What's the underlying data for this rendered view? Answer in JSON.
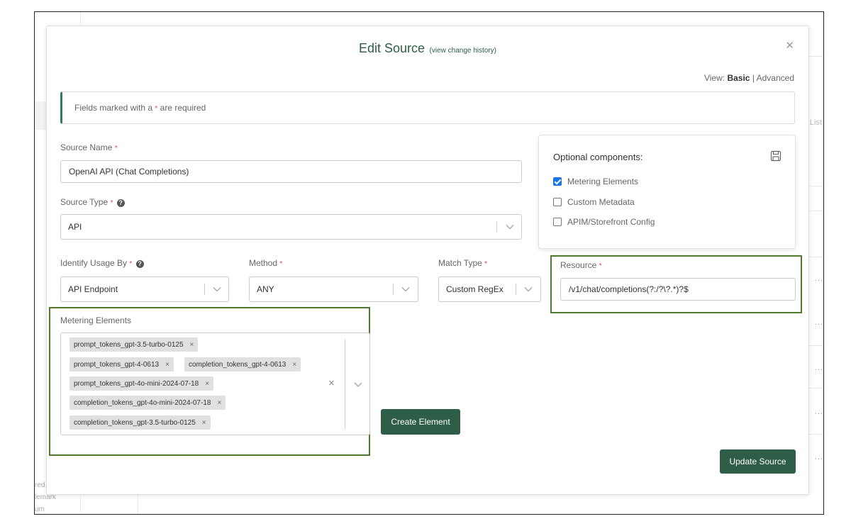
{
  "background": {
    "list_label": "List",
    "row_dots": "...",
    "footer_lines": [
      "red.",
      "lemark",
      "um"
    ]
  },
  "modal": {
    "title": "Edit Source",
    "history_link": "(view change history)",
    "close_icon": "close-icon",
    "view": {
      "label": "View:",
      "basic": "Basic",
      "separator": "|",
      "advanced": "Advanced"
    },
    "required_note": {
      "prefix": "Fields marked with a",
      "asterisk": "*",
      "suffix": "are required"
    },
    "source_name": {
      "label": "Source Name",
      "value": "OpenAI API (Chat Completions)"
    },
    "source_type": {
      "label": "Source Type",
      "value": "API"
    },
    "identify_usage_by": {
      "label": "Identify Usage By",
      "value": "API Endpoint"
    },
    "method": {
      "label": "Method",
      "value": "ANY"
    },
    "match_type": {
      "label": "Match Type",
      "value": "Custom RegEx"
    },
    "resource": {
      "label": "Resource",
      "value": "/v1/chat/completions(?:/?\\?.*)?$"
    },
    "optional_components": {
      "title": "Optional components:",
      "save_icon": "save-icon",
      "items": [
        {
          "label": "Metering Elements",
          "checked": true
        },
        {
          "label": "Custom Metadata",
          "checked": false
        },
        {
          "label": "APIM/Storefront Config",
          "checked": false
        }
      ]
    },
    "metering_elements": {
      "label": "Metering Elements",
      "tags": [
        "prompt_tokens_gpt-3.5-turbo-0125",
        "prompt_tokens_gpt-4-0613",
        "completion_tokens_gpt-4-0613",
        "prompt_tokens_gpt-4o-mini-2024-07-18",
        "completion_tokens_gpt-4o-mini-2024-07-18",
        "completion_tokens_gpt-3.5-turbo-0125"
      ],
      "remove_glyph": "×",
      "clear_glyph": "×"
    },
    "create_element_label": "Create Element",
    "update_source_label": "Update Source"
  },
  "colors": {
    "brand_green": "#2e5e48",
    "title_green": "#2f5e44",
    "highlight_green": "#4f7a2c",
    "required_red": "#e04848",
    "checkbox_blue": "#1a73e8"
  }
}
